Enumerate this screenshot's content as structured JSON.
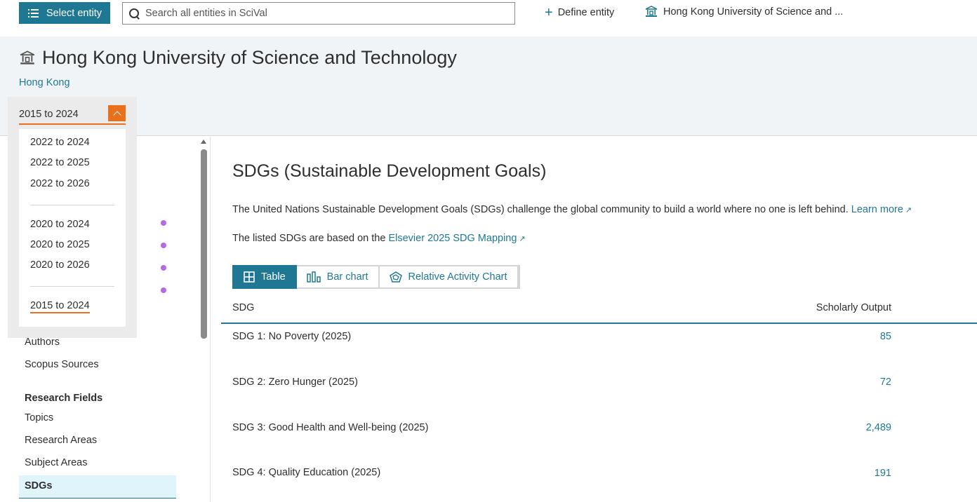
{
  "topbar": {
    "select_entity_label": "Select entity",
    "search_placeholder": "Search all entities in SciVal",
    "define_entity_label": "Define entity",
    "current_entity_label": "Hong Kong University of Science and ..."
  },
  "header": {
    "title": "Hong Kong University of Science and Technology",
    "region": "Hong Kong"
  },
  "period_dropdown": {
    "selected": "2015 to 2024",
    "groups": [
      [
        "2022 to 2024",
        "2022 to 2025",
        "2022 to 2026"
      ],
      [
        "2020 to 2024",
        "2020 to 2025",
        "2020 to 2026"
      ],
      [
        "2015 to 2024"
      ]
    ]
  },
  "sidebar": {
    "items_top": [
      "Authors",
      "Scopus Sources"
    ],
    "section_heading": "Research Fields",
    "items": [
      "Topics",
      "Research Areas",
      "Subject Areas"
    ],
    "active_item": "SDGs"
  },
  "main": {
    "heading": "SDGs (Sustainable Development Goals)",
    "intro_text": "The United Nations Sustainable Development Goals (SDGs) challenge the global community to build a world where no one is left behind.",
    "learn_more": "Learn more",
    "mapping_text": "The listed SDGs are based on the",
    "mapping_link": "Elsevier 2025 SDG Mapping",
    "tabs": [
      "Table",
      "Bar chart",
      "Relative Activity Chart"
    ],
    "table": {
      "col_sdg": "SDG",
      "col_output": "Scholarly Output",
      "rows": [
        {
          "name": "SDG 1: No Poverty (2025)",
          "value": "85"
        },
        {
          "name": "SDG 2: Zero Hunger (2025)",
          "value": "72"
        },
        {
          "name": "SDG 3: Good Health and Well-being (2025)",
          "value": "2,489"
        },
        {
          "name": "SDG 4: Quality Education (2025)",
          "value": "191"
        }
      ]
    }
  },
  "colors": {
    "primary": "#1f7893",
    "accent": "#e9711c",
    "dot": "#b46ae4"
  }
}
